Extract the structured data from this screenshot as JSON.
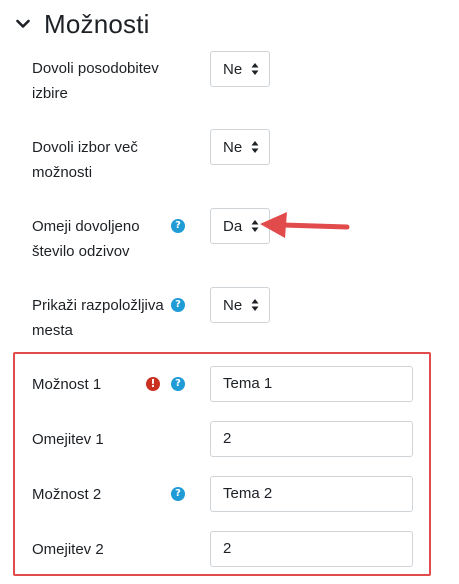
{
  "section": {
    "title": "Možnosti",
    "icon": "chevron-down-icon"
  },
  "options": [
    {
      "label_line1": "Dovoli posodobitev",
      "label_line2": "izbire",
      "value": "Ne"
    },
    {
      "label_line1": "Dovoli izbor več",
      "label_line2": "možnosti",
      "value": "Ne"
    },
    {
      "label_line1": "Omeji dovoljeno",
      "label_line2": "število odzivov",
      "value": "Da"
    },
    {
      "label_line1": "Prikaži razpoložljiva",
      "label_line2": "mesta",
      "value": "Ne"
    }
  ],
  "choices": [
    {
      "label": "Možnost 1",
      "value": "Tema 1"
    },
    {
      "label": "Omejitev 1",
      "value": "2"
    },
    {
      "label": "Možnost 2",
      "value": "Tema 2"
    },
    {
      "label": "Omejitev 2",
      "value": "2"
    }
  ],
  "icons": {
    "help": "help-icon",
    "error": "error-icon",
    "annotation": "red-arrow"
  },
  "colors": {
    "help": "#1f9bd6",
    "error": "#ca3120",
    "annotation": "#e24b4b"
  }
}
